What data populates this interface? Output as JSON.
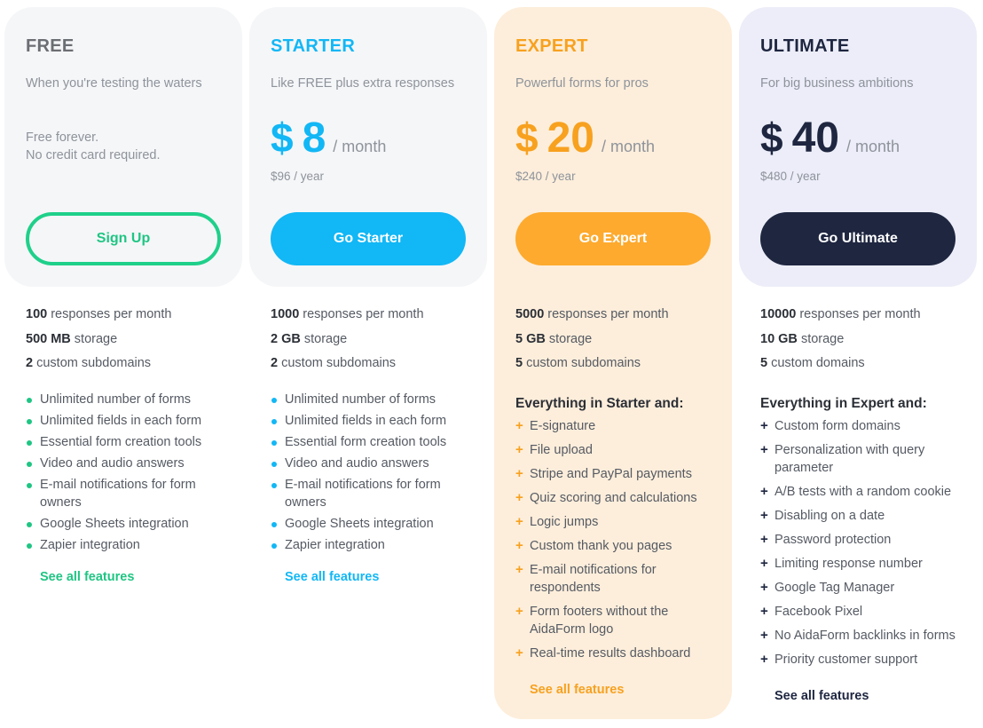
{
  "plans": [
    {
      "id": "free",
      "name": "FREE",
      "tagline": "When you're testing the waters",
      "note_lines": [
        "Free forever.",
        "No credit card required."
      ],
      "cta": "Sign Up",
      "limits": [
        {
          "value": "100",
          "label": " responses per month"
        },
        {
          "value": "500 MB",
          "label": " storage"
        },
        {
          "value": "2",
          "label": " custom subdomains"
        }
      ],
      "features_bullet": "dot",
      "features": [
        "Unlimited number of forms",
        "Unlimited fields in each form",
        "Essential form creation tools",
        "Video and audio answers",
        "E-mail notifications for form owners",
        "Google Sheets integration",
        "Zapier integration"
      ],
      "see_all": "See all features",
      "accent": "#1fc583"
    },
    {
      "id": "starter",
      "name": "STARTER",
      "tagline": "Like FREE plus extra responses",
      "price": {
        "currency": "$",
        "amount": "8",
        "per": "/ month",
        "year_amount": "$96",
        "year_per": " / year"
      },
      "cta": "Go Starter",
      "limits": [
        {
          "value": "1000",
          "label": " responses per month"
        },
        {
          "value": "2 GB",
          "label": " storage"
        },
        {
          "value": "2",
          "label": " custom subdomains"
        }
      ],
      "features_bullet": "dot",
      "features": [
        "Unlimited number of forms",
        "Unlimited fields in each form",
        "Essential form creation tools",
        "Video and audio answers",
        "E-mail notifications for form owners",
        "Google Sheets integration",
        "Zapier integration"
      ],
      "see_all": "See all features",
      "accent": "#12b7f5"
    },
    {
      "id": "expert",
      "name": "EXPERT",
      "tagline": "Powerful forms for pros",
      "price": {
        "currency": "$",
        "amount": "20",
        "per": "/ month",
        "year_amount": "$240",
        "year_per": " / year"
      },
      "cta": "Go Expert",
      "limits": [
        {
          "value": "5000",
          "label": " responses per month"
        },
        {
          "value": "5 GB",
          "label": " storage"
        },
        {
          "value": "5",
          "label": " custom subdomains"
        }
      ],
      "group_title": "Everything in Starter and:",
      "features_bullet": "plus",
      "features": [
        "E-signature",
        "File upload",
        "Stripe and PayPal payments",
        "Quiz scoring and calculations",
        "Logic jumps",
        "Custom thank you pages",
        "E-mail notifications for respondents",
        "Form footers without the AidaForm logo",
        "Real-time results dashboard"
      ],
      "see_all": "See all features",
      "accent": "#f7a11f"
    },
    {
      "id": "ultimate",
      "name": "ULTIMATE",
      "tagline": "For big business ambitions",
      "price": {
        "currency": "$",
        "amount": "40",
        "per": "/ month",
        "year_amount": "$480",
        "year_per": " / year"
      },
      "cta": "Go Ultimate",
      "limits": [
        {
          "value": "10000",
          "label": " responses per month"
        },
        {
          "value": "10 GB",
          "label": " storage"
        },
        {
          "value": "5",
          "label": " custom domains"
        }
      ],
      "group_title": "Everything in Expert and:",
      "features_bullet": "plus",
      "features": [
        "Custom form domains",
        "Personalization with query parameter",
        "A/B tests with a random cookie",
        "Disabling on a date",
        "Password protection",
        "Limiting response number",
        "Google Tag Manager",
        "Facebook Pixel",
        "No AidaForm backlinks in forms",
        "Priority customer support"
      ],
      "see_all": "See all features",
      "accent": "#1e2640"
    }
  ],
  "icons": {
    "dot": "bullet-dot-icon",
    "plus": "plus-icon",
    "plus_glyph": "+"
  }
}
